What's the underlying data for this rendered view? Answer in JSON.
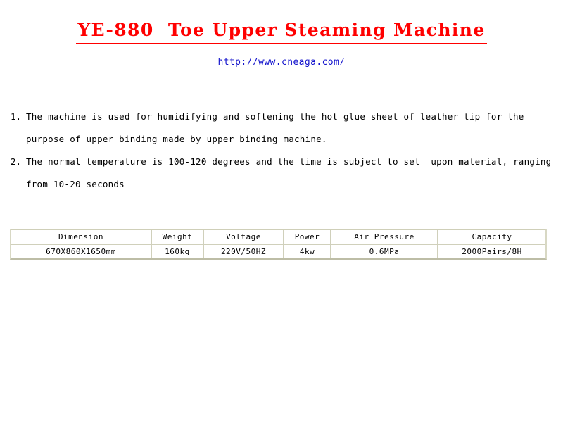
{
  "document": {
    "title": "YE-880  Toe Upper Steaming Machine",
    "url": "http://www.cneaga.com/",
    "title_color": "#ff0000",
    "url_color": "#1111cc"
  },
  "description": {
    "items": [
      {
        "marker": "1.",
        "text": "The machine is used for humidifying and softening the hot glue sheet of leather tip for the purpose of upper binding made by upper binding machine."
      },
      {
        "marker": "2.",
        "text": "The normal temperature is 100-120 degrees and the time is subject to set  upon material, ranging from 10-20 seconds"
      }
    ]
  },
  "spec_table": {
    "headers": [
      "Dimension",
      "Weight",
      "Voltage",
      "Power",
      "Air Pressure",
      "Capacity"
    ],
    "values": [
      "670X860X1650mm",
      "160kg",
      "220V/50HZ",
      "4kw",
      "0.6MPa",
      "2000Pairs/8H"
    ],
    "border_color": "#d0d0bb"
  }
}
